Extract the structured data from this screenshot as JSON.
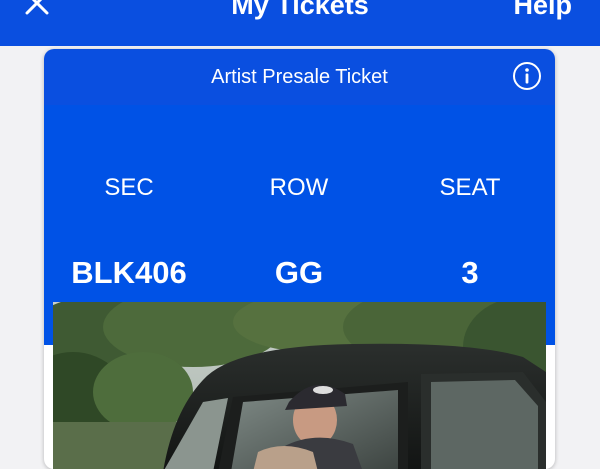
{
  "header": {
    "title": "My Tickets",
    "help_label": "Help"
  },
  "ticket": {
    "title": "Artist Presale Ticket",
    "section_label": "SEC",
    "section_value": "BLK406",
    "row_label": "ROW",
    "row_value": "GG",
    "seat_label": "SEAT",
    "seat_value": "3"
  },
  "colors": {
    "brand_blue": "#0a4fe0",
    "panel_blue": "#0052e6"
  },
  "icons": {
    "close": "close-icon",
    "info": "info-icon"
  }
}
